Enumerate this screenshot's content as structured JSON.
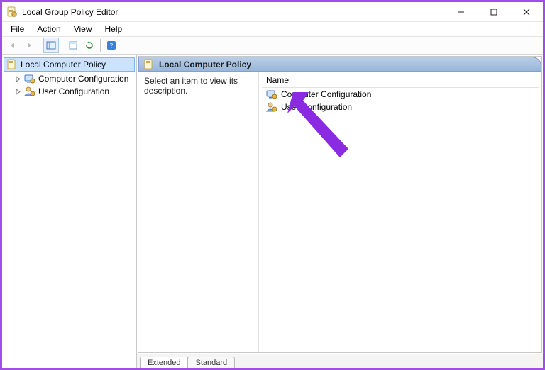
{
  "window": {
    "title": "Local Group Policy Editor"
  },
  "menubar": {
    "items": [
      "File",
      "Action",
      "View",
      "Help"
    ]
  },
  "toolbar": {
    "buttons": [
      {
        "name": "back-icon",
        "disabled": true
      },
      {
        "name": "forward-icon",
        "disabled": true
      },
      {
        "name": "separator"
      },
      {
        "name": "show-hide-tree-icon",
        "framed": true
      },
      {
        "name": "separator"
      },
      {
        "name": "properties-icon"
      },
      {
        "name": "refresh-icon"
      },
      {
        "name": "separator"
      },
      {
        "name": "help-icon"
      }
    ]
  },
  "tree": {
    "root": {
      "label": "Local Computer Policy",
      "selected": true
    },
    "children": [
      {
        "label": "Computer Configuration"
      },
      {
        "label": "User Configuration"
      }
    ]
  },
  "content": {
    "header": "Local Computer Policy",
    "description": "Select an item to view its description.",
    "list": {
      "column_header": "Name",
      "items": [
        {
          "label": "Computer Configuration",
          "icon": "computer-config-icon"
        },
        {
          "label": "User Configuration",
          "icon": "user-config-icon"
        }
      ]
    }
  },
  "bottom_tabs": {
    "items": [
      "Extended",
      "Standard"
    ],
    "active_index": 0
  },
  "annotation": {
    "type": "arrow",
    "color": "#8a2be2"
  }
}
